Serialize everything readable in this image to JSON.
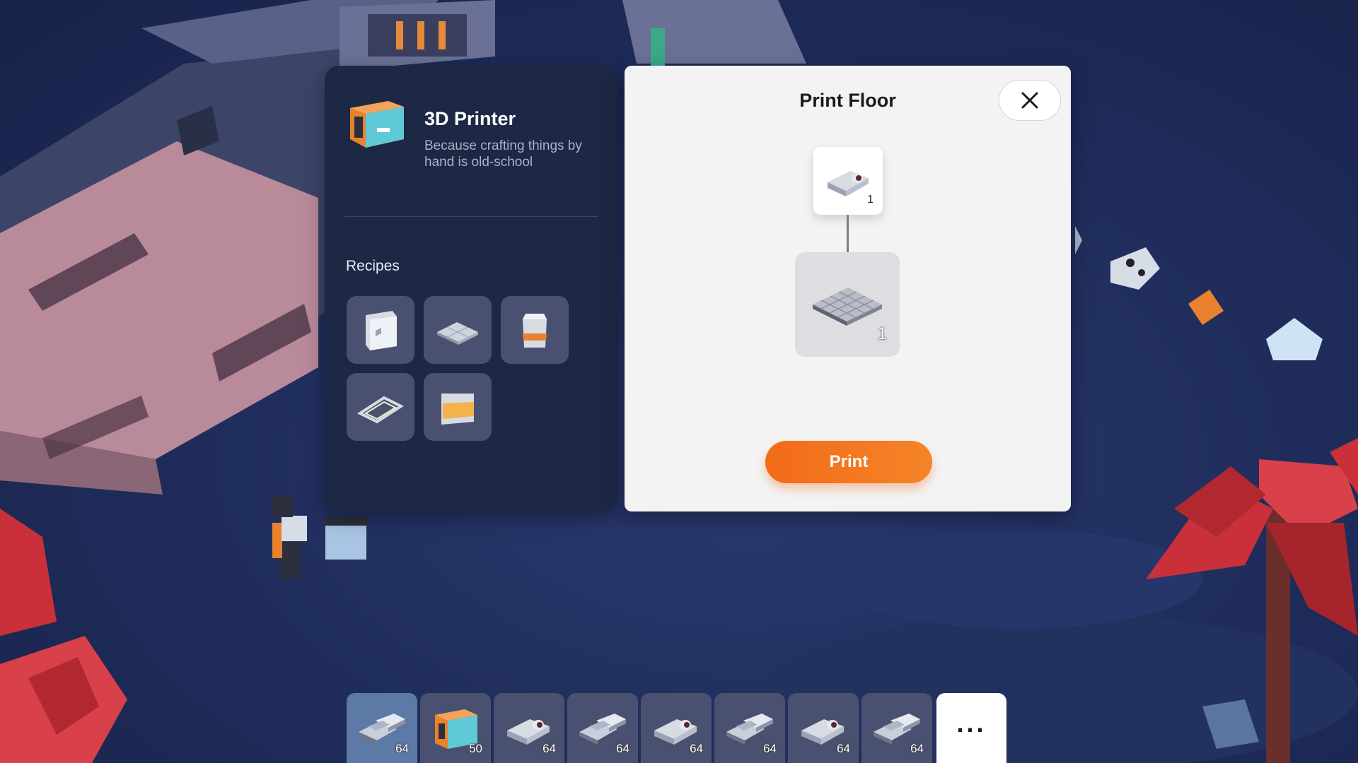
{
  "scene": {
    "palette": {
      "ground": "#1f2c5a",
      "base_wall": "#b98a9a",
      "palm": "#c9303a",
      "rock": "#cfe3f4"
    }
  },
  "printer_panel": {
    "title": "3D Printer",
    "subtitle": "Because crafting things by hand is old-school",
    "recipes_label": "Recipes",
    "recipes": [
      {
        "icon": "wall-panel-icon"
      },
      {
        "icon": "floor-tile-icon"
      },
      {
        "icon": "canister-icon"
      },
      {
        "icon": "light-frame-icon"
      },
      {
        "icon": "window-panel-icon"
      }
    ]
  },
  "print_panel": {
    "title": "Print Floor",
    "ingredient": {
      "icon": "metal-ingot-icon",
      "quantity": "1"
    },
    "output": {
      "icon": "floor-tile-icon",
      "quantity": "1"
    },
    "print_label": "Print",
    "accent_color": "#f26b18"
  },
  "hotbar": {
    "slots": [
      {
        "icon": "metal-scrap-icon",
        "count": "64",
        "selected": true
      },
      {
        "icon": "3d-printer-icon",
        "count": "50",
        "selected": false
      },
      {
        "icon": "metal-ingot-icon",
        "count": "64",
        "selected": false
      },
      {
        "icon": "metal-scrap-icon",
        "count": "64",
        "selected": false
      },
      {
        "icon": "metal-ingot-icon",
        "count": "64",
        "selected": false
      },
      {
        "icon": "metal-scrap-icon",
        "count": "64",
        "selected": false
      },
      {
        "icon": "metal-ingot-icon",
        "count": "64",
        "selected": false
      },
      {
        "icon": "metal-scrap-icon",
        "count": "64",
        "selected": false
      }
    ],
    "more_label": "..."
  }
}
